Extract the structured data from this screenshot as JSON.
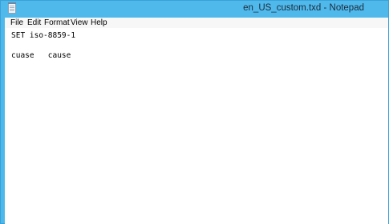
{
  "window": {
    "title": "en_US_custom.txd - Notepad",
    "accent_color": "#4fb9ec",
    "icon": "notepad-app-icon"
  },
  "menubar": {
    "items": [
      {
        "label": "File"
      },
      {
        "label": "Edit"
      },
      {
        "label": "Format"
      },
      {
        "label": "View"
      },
      {
        "label": "Help"
      }
    ]
  },
  "editor": {
    "content": "SET iso-8859-1\n\ncuase   cause"
  }
}
